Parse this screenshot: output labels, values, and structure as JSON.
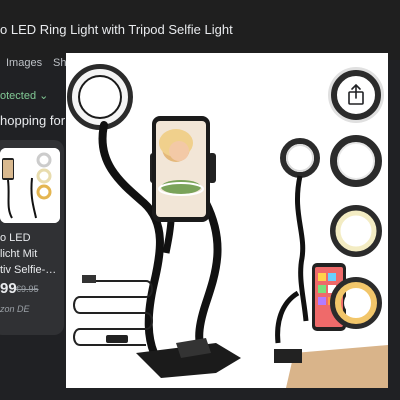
{
  "header": {
    "title": "o LED Ring Light with Tripod Selfie Light"
  },
  "tabs": [
    {
      "label": "Images"
    },
    {
      "label": "Sh"
    }
  ],
  "filter": {
    "label": "otected ⌄"
  },
  "section": {
    "heading": "hopping for"
  },
  "product_card": {
    "line1": "o LED",
    "line2": "licht Mit",
    "line3": "tiv Selfie-…",
    "price": "99",
    "old_price": "€9.95",
    "store": "zon DE"
  },
  "icons": {
    "share": "share-icon"
  },
  "colors": {
    "background": "#202124",
    "protected": "#81c995"
  }
}
